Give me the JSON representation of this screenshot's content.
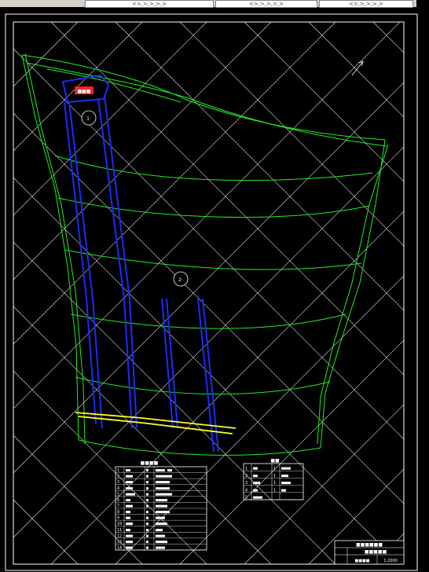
{
  "toolbar": {
    "tabs": [
      {
        "label": "<>,>,>,>,>"
      },
      {
        "label": "<>,>,>,>,>"
      },
      {
        "label": "<>,>,>,>,>"
      }
    ]
  },
  "colors": {
    "background": "#000000",
    "frame": "#ffffff",
    "grid": "#ffffff",
    "contours": "#22ee22",
    "roadway": "#1a2cff",
    "highlight_line": "#ffff22",
    "label_red": "#ff2020"
  },
  "drawing": {
    "tag_red": "■■■",
    "circle_label_1": "1·",
    "circle_label_2": "2·",
    "table_left": {
      "title": "■■■■",
      "rows": [
        {
          "no": "1",
          "a": "■■",
          "b": "■",
          "c": "■■■■ ■■"
        },
        {
          "no": "2",
          "a": "■■■",
          "b": "■",
          "c": "■■■■■■■"
        },
        {
          "no": "3",
          "a": "■■■",
          "b": "■",
          "c": "■■■■■■"
        },
        {
          "no": "4",
          "a": "■■■",
          "b": "■",
          "c": "■■■■■■"
        },
        {
          "no": "5",
          "a": "■■■■",
          "b": "■",
          "c": "■■■■■■■"
        },
        {
          "no": "6",
          "a": "■■",
          "b": "■",
          "c": "■■■■■"
        },
        {
          "no": "7",
          "a": "■■■",
          "b": "■",
          "c": "■■■■■"
        },
        {
          "no": "8",
          "a": "■■",
          "b": "■",
          "c": "■■■■■■"
        },
        {
          "no": "9",
          "a": "■■",
          "b": "■",
          "c": "■■■■"
        },
        {
          "no": "10",
          "a": "■■■",
          "b": "■",
          "c": "■■■■■"
        },
        {
          "no": "11",
          "a": "■■",
          "b": "■",
          "c": "■■■"
        },
        {
          "no": "12",
          "a": "■■■",
          "b": "■",
          "c": "■■■■"
        },
        {
          "no": "13",
          "a": "■■■",
          "b": "■",
          "c": "■■■■■"
        },
        {
          "no": "14",
          "a": "■■■",
          "b": "■",
          "c": "■■■■"
        }
      ]
    },
    "table_right": {
      "title": "■■",
      "rows": [
        {
          "no": "1",
          "a": "■■",
          "b": "1",
          "c": "■■■■"
        },
        {
          "no": "2",
          "a": "■■",
          "b": "1",
          "c": "■■■"
        },
        {
          "no": "3",
          "a": "■■■",
          "b": "1",
          "c": "■■■■"
        },
        {
          "no": "4",
          "a": "■■",
          "b": "1",
          "c": "■■"
        },
        {
          "no": "5",
          "a": "■■■■",
          "b": "",
          "c": ""
        }
      ]
    },
    "title_block": {
      "name": "■■■■■■",
      "sub": "■■■■■",
      "code": "■■■■",
      "scale": "1:2000"
    }
  }
}
